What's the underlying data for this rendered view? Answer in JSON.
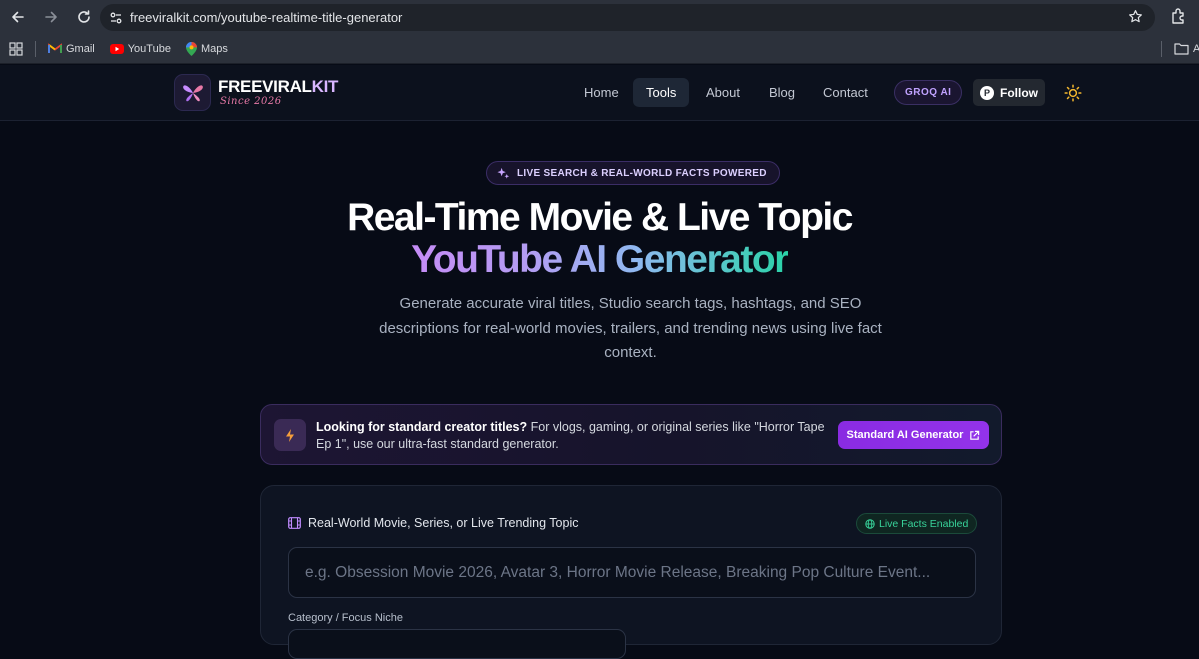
{
  "browser": {
    "url": "freeviralkit.com/youtube-realtime-title-generator",
    "bookmarks": [
      "Gmail",
      "YouTube",
      "Maps"
    ],
    "bookmark_folder": "A"
  },
  "header": {
    "logo_part1": "FREEVIRAL",
    "logo_part2": "KIT",
    "logo_sub": "Since 2026",
    "nav": [
      "Home",
      "Tools",
      "About",
      "Blog",
      "Contact"
    ],
    "active_nav": "Tools",
    "groq_label": "GROQ AI",
    "follow_label": "Follow",
    "follow_badge": "P"
  },
  "hero": {
    "badge": "LIVE SEARCH & REAL-WORLD FACTS POWERED",
    "title_line1": "Real-Time Movie & Live Topic",
    "title_line2": "YouTube AI Generator",
    "description": "Generate accurate viral titles, Studio search tags, hashtags, and SEO descriptions for real-world movies, trailers, and trending news using live fact context."
  },
  "banner": {
    "bold": "Looking for standard creator titles?",
    "text": " For vlogs, gaming, or original series like \"Horror Tape Ep 1\", use our ultra-fast standard generator.",
    "button": "Standard AI Generator"
  },
  "form": {
    "topic_label": "Real-World Movie, Series, or Live Trending Topic",
    "live_pill": "Live Facts Enabled",
    "topic_placeholder": "e.g. Obsession Movie 2026, Avatar 3, Horror Movie Release, Breaking Pop Culture Event...",
    "category_label": "Category / Focus Niche"
  },
  "colors": {
    "accent": "#9333ea",
    "live": "#38d39a",
    "gradient_start": "#c58cf6",
    "gradient_end": "#2ad3a8"
  }
}
